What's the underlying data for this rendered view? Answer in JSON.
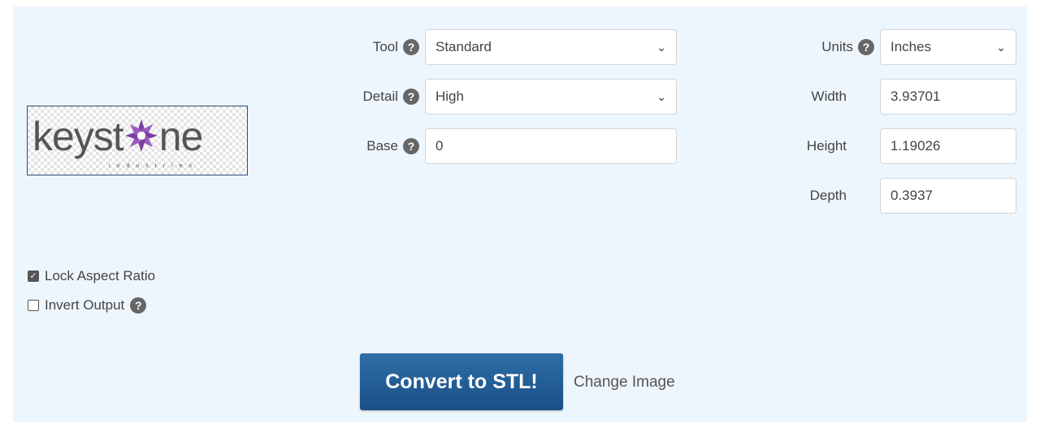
{
  "logo": {
    "word_start": "keyst",
    "word_end": "ne",
    "subtitle": "industries"
  },
  "tool": {
    "label": "Tool",
    "value": "Standard"
  },
  "detail": {
    "label": "Detail",
    "value": "High"
  },
  "base": {
    "label": "Base",
    "value": "0"
  },
  "units": {
    "label": "Units",
    "value": "Inches"
  },
  "width": {
    "label": "Width",
    "value": "3.93701"
  },
  "height": {
    "label": "Height",
    "value": "1.19026"
  },
  "depth": {
    "label": "Depth",
    "value": "0.3937"
  },
  "lock_aspect": {
    "label": "Lock Aspect Ratio",
    "checked": true
  },
  "invert_output": {
    "label": "Invert Output",
    "checked": false
  },
  "help_glyph": "?",
  "chevron_glyph": "⌄",
  "convert_label": "Convert to STL!",
  "change_image_label": "Change Image",
  "colors": {
    "panel": "#eef6fd",
    "button": "#1f5c99",
    "logo_star": "#7b3fa0"
  }
}
